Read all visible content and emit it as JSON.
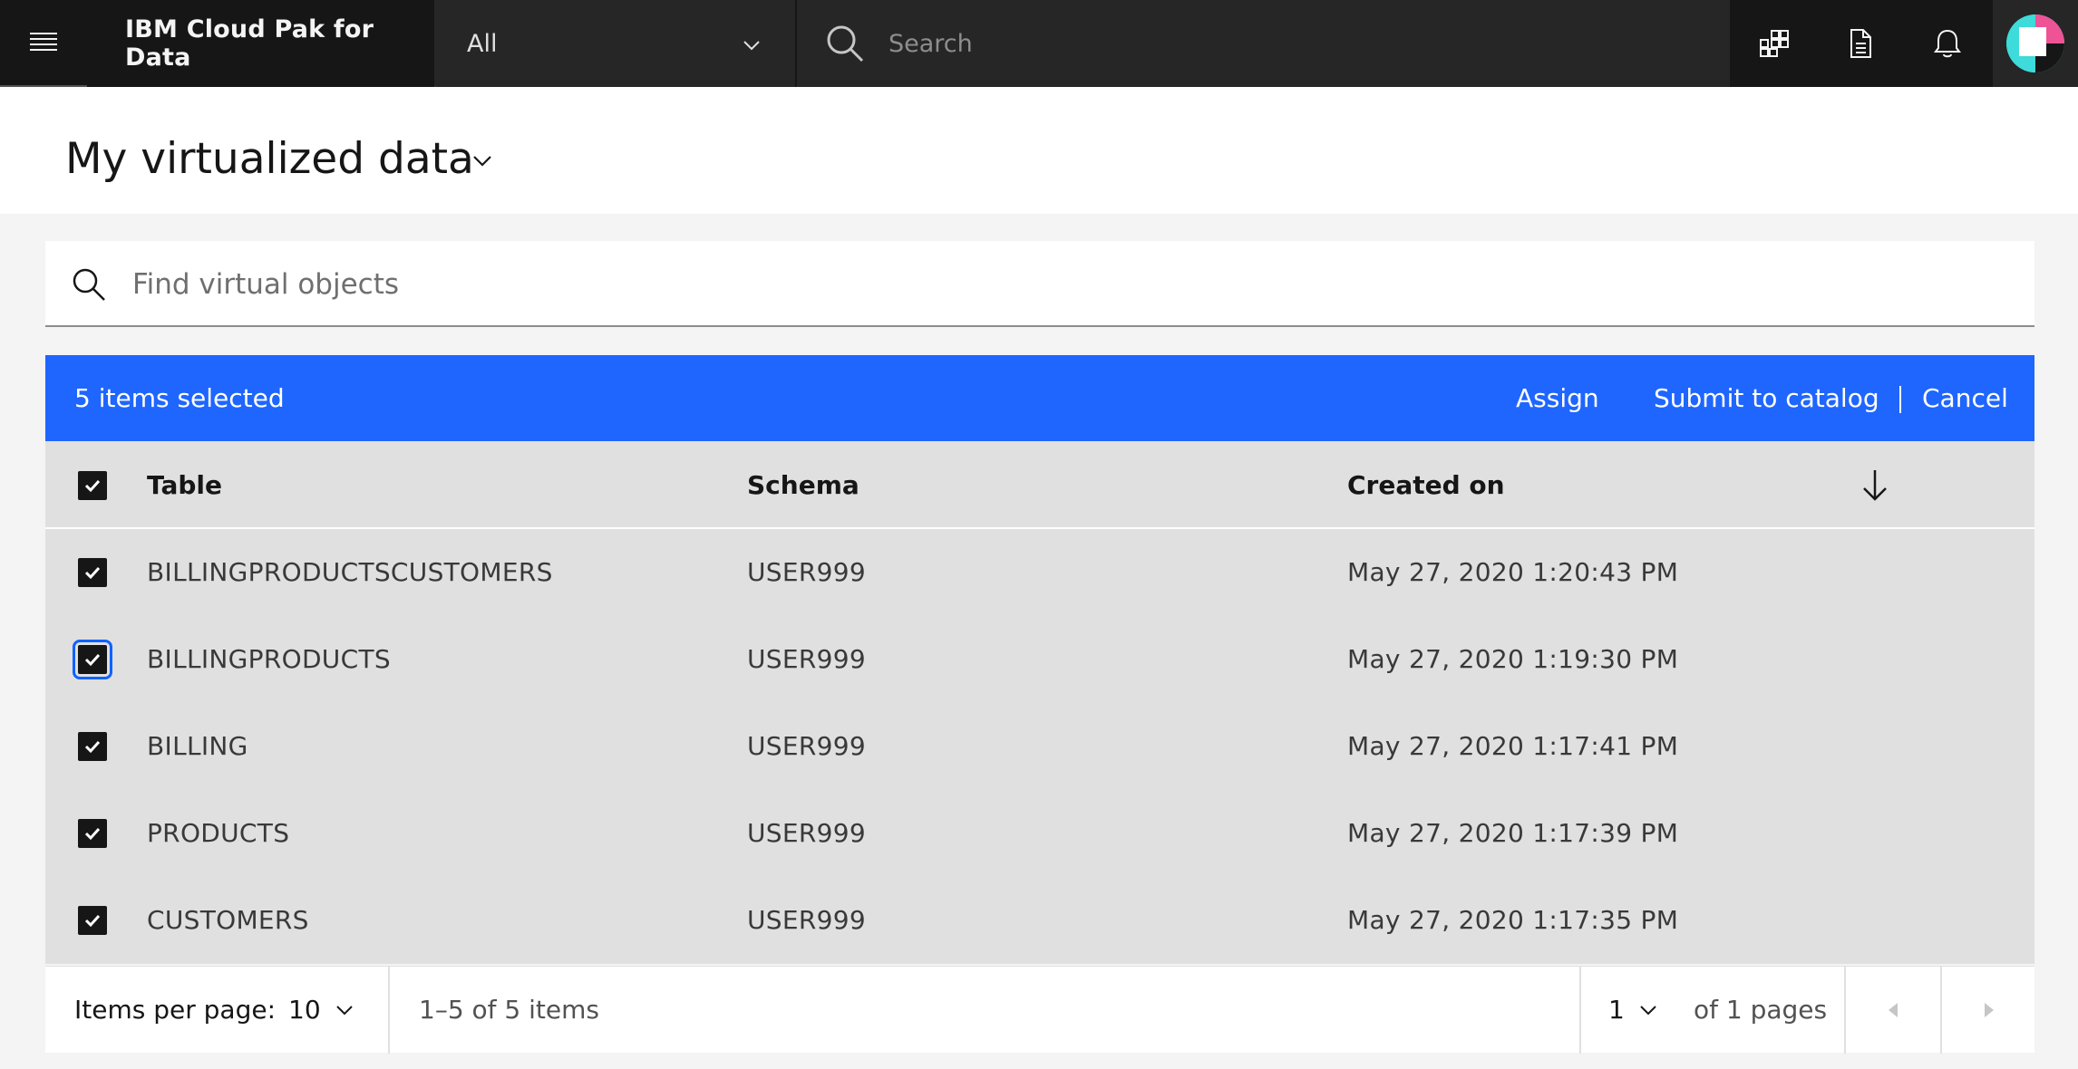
{
  "header": {
    "brand": "IBM Cloud Pak for Data",
    "scope_value": "All",
    "search_placeholder": "Search"
  },
  "page": {
    "title": "My virtualized data"
  },
  "object_search": {
    "placeholder": "Find virtual objects"
  },
  "batch_actions": {
    "selected_label": "5 items selected",
    "assign": "Assign",
    "submit": "Submit to catalog",
    "cancel": "Cancel"
  },
  "table": {
    "columns": [
      "Table",
      "Schema",
      "Created on"
    ],
    "rows": [
      {
        "table": "BILLINGPRODUCTSCUSTOMERS",
        "schema": "USER999",
        "created": "May 27, 2020 1:20:43 PM"
      },
      {
        "table": "BILLINGPRODUCTS",
        "schema": "USER999",
        "created": "May 27, 2020 1:19:30 PM"
      },
      {
        "table": "BILLING",
        "schema": "USER999",
        "created": "May 27, 2020 1:17:41 PM"
      },
      {
        "table": "PRODUCTS",
        "schema": "USER999",
        "created": "May 27, 2020 1:17:39 PM"
      },
      {
        "table": "CUSTOMERS",
        "schema": "USER999",
        "created": "May 27, 2020 1:17:35 PM"
      }
    ]
  },
  "pagination": {
    "items_per_page_label": "Items per page:",
    "items_per_page_value": "10",
    "range_text": "1–5 of 5 items",
    "current_page": "1",
    "of_pages_text": "of 1 pages"
  },
  "icons": {
    "menu": "hamburger-menu-icon",
    "search": "search-icon",
    "apps": "app-switcher-icon",
    "document": "document-icon",
    "notification": "notification-bell-icon",
    "avatar": "user-avatar",
    "checkbox": "checkmark-icon",
    "sort": "arrow-down-icon",
    "prev": "caret-left-icon",
    "next": "caret-right-icon"
  },
  "colors": {
    "header_bg": "#262626",
    "brand_bg": "#161616",
    "batch_bar": "#1f66ff",
    "table_bg": "#e0e0e0",
    "page_bg": "#f4f4f4"
  }
}
